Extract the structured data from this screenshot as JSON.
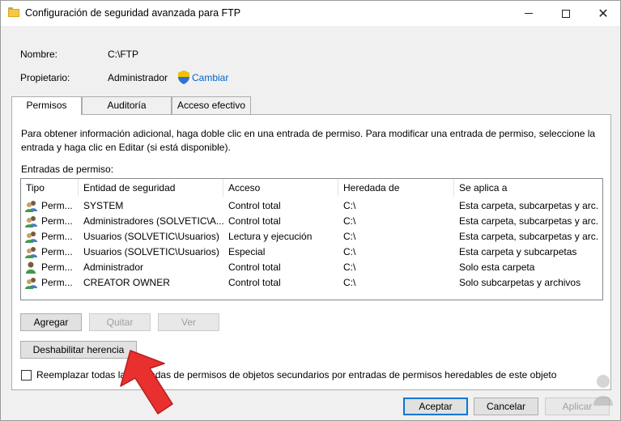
{
  "window": {
    "title": "Configuración de seguridad avanzada para FTP"
  },
  "info": {
    "name_label": "Nombre:",
    "name_value": "C:\\FTP",
    "owner_label": "Propietario:",
    "owner_value": "Administrador",
    "change_link": "Cambiar"
  },
  "tabs": [
    {
      "label": "Permisos",
      "active": true
    },
    {
      "label": "Auditoría",
      "active": false
    },
    {
      "label": "Acceso efectivo",
      "active": false
    }
  ],
  "panel": {
    "description": "Para obtener información adicional, haga doble clic en una entrada de permiso. Para modificar una entrada de permiso, seleccione la entrada y haga clic en Editar (si está disponible).",
    "entries_label": "Entradas de permiso:"
  },
  "table": {
    "headers": [
      "Tipo",
      "Entidad de seguridad",
      "Acceso",
      "Heredada de",
      "Se aplica a"
    ],
    "rows": [
      {
        "type": "Perm...",
        "principal": "SYSTEM",
        "access": "Control total",
        "inherited": "C:\\",
        "applies": "Esta carpeta, subcarpetas y arc..."
      },
      {
        "type": "Perm...",
        "principal": "Administradores (SOLVETIC\\A...",
        "access": "Control total",
        "inherited": "C:\\",
        "applies": "Esta carpeta, subcarpetas y arc..."
      },
      {
        "type": "Perm...",
        "principal": "Usuarios (SOLVETIC\\Usuarios)",
        "access": "Lectura y ejecución",
        "inherited": "C:\\",
        "applies": "Esta carpeta, subcarpetas y arc..."
      },
      {
        "type": "Perm...",
        "principal": "Usuarios (SOLVETIC\\Usuarios)",
        "access": "Especial",
        "inherited": "C:\\",
        "applies": "Esta carpeta y subcarpetas"
      },
      {
        "type": "Perm...",
        "principal": "Administrador",
        "access": "Control total",
        "inherited": "C:\\",
        "applies": "Solo esta carpeta"
      },
      {
        "type": "Perm...",
        "principal": "CREATOR OWNER",
        "access": "Control total",
        "inherited": "C:\\",
        "applies": "Solo subcarpetas y archivos"
      }
    ]
  },
  "buttons": {
    "add": "Agregar",
    "remove": "Quitar",
    "view": "Ver",
    "disable_inheritance": "Deshabilitar herencia",
    "accept": "Aceptar",
    "cancel": "Cancelar",
    "apply": "Aplicar"
  },
  "checkbox": {
    "label": "Reemplazar todas las entradas de permisos de objetos secundarios por entradas de permisos heredables de este objeto",
    "checked": false
  },
  "colors": {
    "link": "#0066cc",
    "arrow": "#e8302f",
    "default_button_border": "#0078d7"
  }
}
